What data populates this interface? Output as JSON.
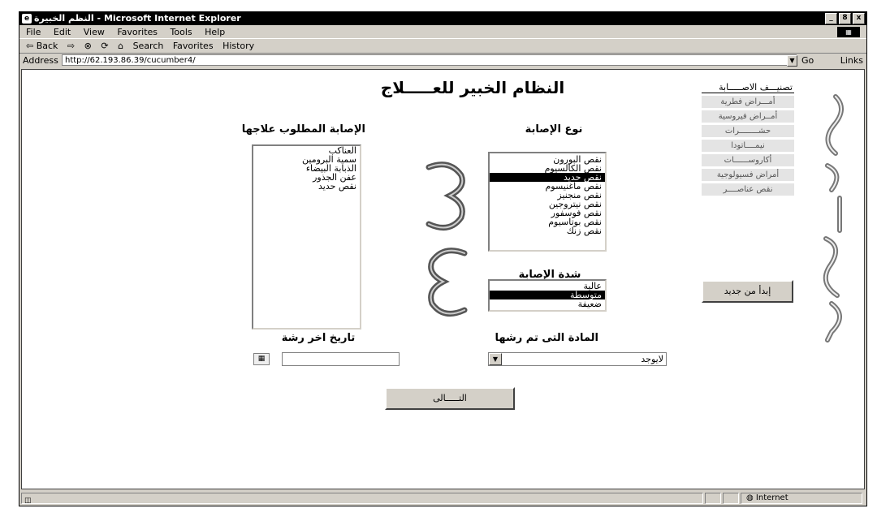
{
  "window": {
    "title": "النظم الخبيرة - Microsoft Internet Explorer",
    "controls": [
      "_",
      "8",
      "x"
    ]
  },
  "menu": [
    "File",
    "Edit",
    "View",
    "Favorites",
    "Tools",
    "Help"
  ],
  "toolbar": [
    "⇦ Back",
    "⇨",
    "⊗",
    "⟳",
    "⌂",
    "Search",
    "Favorites",
    "History"
  ],
  "address": {
    "label": "Address",
    "url": "http://62.193.86.39/cucumber4/",
    "go": "Go",
    "links": "Links"
  },
  "page": {
    "title": "النظام الخبير للعـــــلاج",
    "infection_type": {
      "label": "نوع الإصابة",
      "options": [
        "نقص البورون",
        "نقص الكالسيوم",
        "نقص حديد",
        "نقص ماغنيسوم",
        "نقص منجنيز",
        "نقص نيتروجين",
        "نقص فوسفور",
        "نقص بوتاسيوم",
        "نقص زنك"
      ],
      "selected_index": 2
    },
    "to_treat": {
      "label": "الإصابة المطلوب علاجها",
      "options": [
        "العناكب",
        "سمية البرومين",
        "الذبابة البيضاء",
        "عفن الجذور",
        "نقص حديد"
      ]
    },
    "severity": {
      "label": "شدة الإصابة",
      "options": [
        "عالية",
        "متوسطة",
        "ضعيفة"
      ],
      "selected_index": 1
    },
    "sprayed_material": {
      "label": "المادة التى تم رشها",
      "value": "لايوجد"
    },
    "last_spray_date": {
      "label": "تاريخ اخر رشة",
      "value": ""
    },
    "next_button": "التـــــالى",
    "restart_button": "إبدأ من جديد"
  },
  "side_menu": {
    "title": "تصنيـــف الاصـــــابة",
    "items": [
      "أمـــراض فطرية",
      "أمــراض فيروسية",
      "حشــــــــرات",
      "نيمــــاتودا",
      "أكاروســــــات",
      "أمراض فسيولوجية",
      "نقص عناصــــر"
    ]
  },
  "status": {
    "zone": "Internet"
  }
}
